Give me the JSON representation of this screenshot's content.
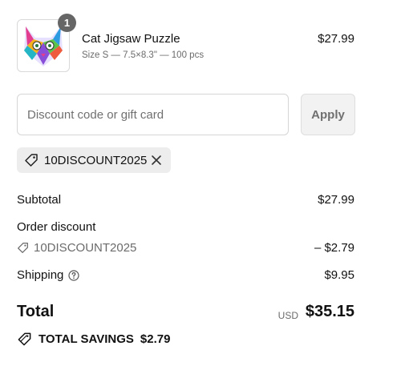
{
  "product": {
    "quantity": "1",
    "name": "Cat Jigsaw Puzzle",
    "variant": "Size S — 7.5×8.3\" — 100 pcs",
    "price": "$27.99",
    "image_icon": "cat-puzzle-thumbnail"
  },
  "discount": {
    "placeholder": "Discount code or gift card",
    "value": "",
    "apply_label": "Apply",
    "applied_code": "10DISCOUNT2025",
    "remove_icon": "close-icon"
  },
  "summary": {
    "subtotal_label": "Subtotal",
    "subtotal_value": "$27.99",
    "order_discount_label": "Order discount",
    "order_discount_code": "10DISCOUNT2025",
    "order_discount_value": "– $2.79",
    "shipping_label": "Shipping",
    "shipping_value": "$9.95",
    "total_label": "Total",
    "currency": "USD",
    "total_value": "$35.15",
    "savings_label": "TOTAL SAVINGS",
    "savings_value": "$2.79"
  },
  "colors": {
    "text": "#111111",
    "muted": "#6b6b6b",
    "badge": "#666666",
    "chip_bg": "#ededed",
    "button_bg": "#f2f2f2",
    "border": "#d6d6d6"
  }
}
